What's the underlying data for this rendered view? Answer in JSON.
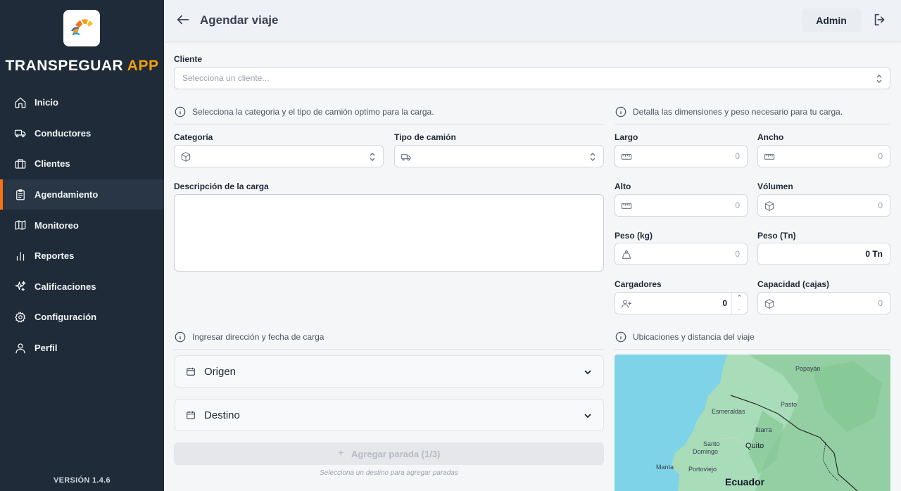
{
  "sidebar": {
    "brand_main": "TRANSPEGUAR",
    "brand_accent": "APP",
    "items": [
      {
        "label": "Inicio",
        "icon": "home-icon"
      },
      {
        "label": "Conductores",
        "icon": "truck-icon"
      },
      {
        "label": "Clientes",
        "icon": "briefcase-icon"
      },
      {
        "label": "Agendamiento",
        "icon": "clipboard-icon",
        "active": true
      },
      {
        "label": "Monitoreo",
        "icon": "map-icon"
      },
      {
        "label": "Reportes",
        "icon": "bar-chart-icon"
      },
      {
        "label": "Calificaciones",
        "icon": "sparkles-icon"
      },
      {
        "label": "Configuración",
        "icon": "gear-icon"
      },
      {
        "label": "Perfil",
        "icon": "user-icon"
      }
    ],
    "version": "VERSIÓN 1.4.6"
  },
  "header": {
    "title": "Agendar viaje",
    "user_button": "Admin"
  },
  "form": {
    "cliente_label": "Cliente",
    "cliente_placeholder": "Selecciona un cliente...",
    "info_camion": "Selecciona la categoria y el tipo de camión optimo para la carga.",
    "info_dimensiones": "Detalla las dimensiones y peso necesario para tu carga.",
    "categoria_label": "Categoría",
    "tipo_camion_label": "Tipo de camión",
    "descripcion_label": "Descripción de la carga",
    "largo_label": "Largo",
    "largo_value": "0",
    "ancho_label": "Ancho",
    "ancho_value": "0",
    "alto_label": "Alto",
    "alto_value": "0",
    "volumen_label": "Vólumen",
    "volumen_value": "0",
    "peso_kg_label": "Peso (kg)",
    "peso_kg_value": "0",
    "peso_tn_label": "Peso (Tn)",
    "peso_tn_value": "0 Tn",
    "cargadores_label": "Cargadores",
    "cargadores_value": "0",
    "capacidad_label": "Capacidad (cajas)",
    "capacidad_value": "0",
    "info_direccion": "Ingresar dirección y fecha de carga",
    "info_ubicaciones": "Ubicaciones y distancia del viaje",
    "origen_label": "Origen",
    "destino_label": "Destino",
    "add_stop_label": "Agregar parada (1/3)",
    "add_stop_hint": "Selecciona un destino para agregar paradas"
  },
  "map": {
    "labels": {
      "popayan": "Popayán",
      "pasto": "Pasto",
      "esmeraldas": "Esmeraldas",
      "ibarra": "Ibarra",
      "santo_domingo_1": "Santo",
      "santo_domingo_2": "Domingo",
      "quito": "Quito",
      "manta": "Manta",
      "portoviejo": "Portoviejo",
      "ecuador": "Ecuador"
    }
  },
  "colors": {
    "sidebar_bg": "#1f2b38",
    "brand_accent": "#f59e0b",
    "active_indicator": "#f97316"
  }
}
